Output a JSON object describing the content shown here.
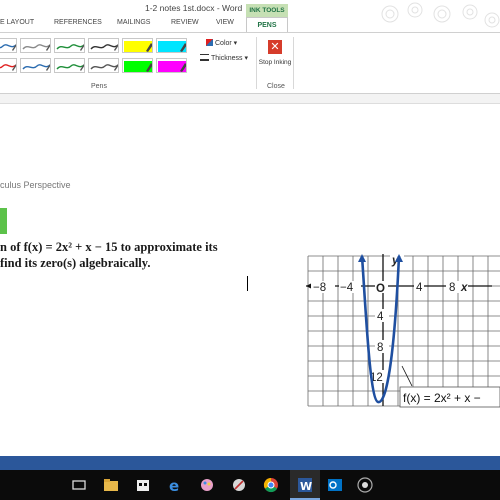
{
  "window": {
    "title": "1-2 notes 1st.docx - Word",
    "contextual_group": "INK TOOLS"
  },
  "tabs": {
    "page_layout": "E LAYOUT",
    "references": "REFERENCES",
    "mailings": "MAILINGS",
    "review": "REVIEW",
    "view": "VIEW",
    "pens": "PENS"
  },
  "ribbon": {
    "pens_group_label": "Pens",
    "close_group_label": "Close",
    "color_label": "Color",
    "thickness_label": "Thickness",
    "stop_inking_label": "Stop Inking",
    "pen_swatches": [
      {
        "color": "#2b6cb0",
        "kind": "pen"
      },
      {
        "color": "#8a8a8a",
        "kind": "pen"
      },
      {
        "color": "#1f8f3a",
        "kind": "pen"
      },
      {
        "color": "#333333",
        "kind": "pen"
      },
      {
        "color": "#ffff00",
        "kind": "highlighter"
      },
      {
        "color": "#00e5ff",
        "kind": "highlighter"
      },
      {
        "color": "#e02020",
        "kind": "pen"
      },
      {
        "color": "#2b6cb0",
        "kind": "pen"
      },
      {
        "color": "#1f8f3a",
        "kind": "pen"
      },
      {
        "color": "#555555",
        "kind": "pen"
      },
      {
        "color": "#00ff00",
        "kind": "highlighter"
      },
      {
        "color": "#ff00ff",
        "kind": "highlighter"
      }
    ]
  },
  "document": {
    "section_label": "culus Perspective",
    "question_line1": "n of f(x) = 2x² + x − 15 to approximate its",
    "question_line2": "find its zero(s) algebraically."
  },
  "graph": {
    "x_ticks": [
      "−8",
      "−4",
      "O",
      "4",
      "8"
    ],
    "x_axis_label": "x",
    "y_axis_label": "y",
    "y_ticks": [
      "4",
      "8",
      "12"
    ],
    "function_label": "f(x) = 2x² + x −"
  },
  "colors": {
    "accent": "#217346",
    "word_blue": "#2b579a",
    "curve": "#1f4fa0",
    "stop_red": "#d63c2b"
  }
}
